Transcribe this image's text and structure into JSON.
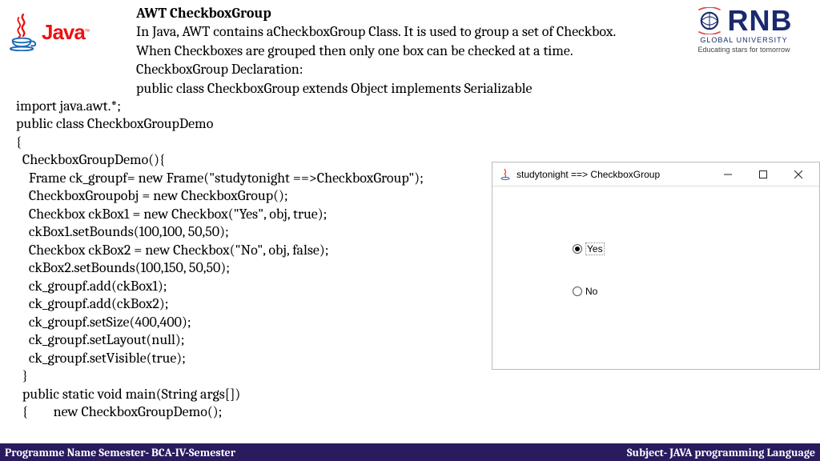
{
  "header": {
    "java_wordmark": "Java",
    "rnb_name": "RNB",
    "rnb_sub": "GLOBAL UNIVERSITY",
    "rnb_tag": "Educating stars for tomorrow"
  },
  "intro": {
    "title": "AWT CheckboxGroup",
    "line1": "In Java, AWT contains aCheckboxGroup Class. It is used to group a set of Checkbox.",
    "line2": "When Checkboxes are grouped then only one box can be checked at a time.",
    "line3": "CheckboxGroup Declaration:",
    "line4": "public class CheckboxGroup extends Object implements Serializable"
  },
  "code": "import java.awt.*;\npublic class CheckboxGroupDemo\n{\n  CheckboxGroupDemo(){\n    Frame ck_groupf= new Frame(\"studytonight ==>CheckboxGroup\");\n    CheckboxGroupobj = new CheckboxGroup();\n    Checkbox ckBox1 = new Checkbox(\"Yes\", obj, true);\n    ckBox1.setBounds(100,100, 50,50);\n    Checkbox ckBox2 = new Checkbox(\"No\", obj, false);\n    ckBox2.setBounds(100,150, 50,50);\n    ck_groupf.add(ckBox1);\n    ck_groupf.add(ckBox2);\n    ck_groupf.setSize(400,400);\n    ck_groupf.setLayout(null);\n    ck_groupf.setVisible(true);\n  }\n  public static void main(String args[])\n  {        new CheckboxGroupDemo();",
  "window": {
    "title": "studytonight ==> CheckboxGroup",
    "option_yes": "Yes",
    "option_no": "No"
  },
  "footer": {
    "left": "Programme Name Semester- BCA-IV-Semester",
    "right": "Subject- JAVA programming Language"
  }
}
